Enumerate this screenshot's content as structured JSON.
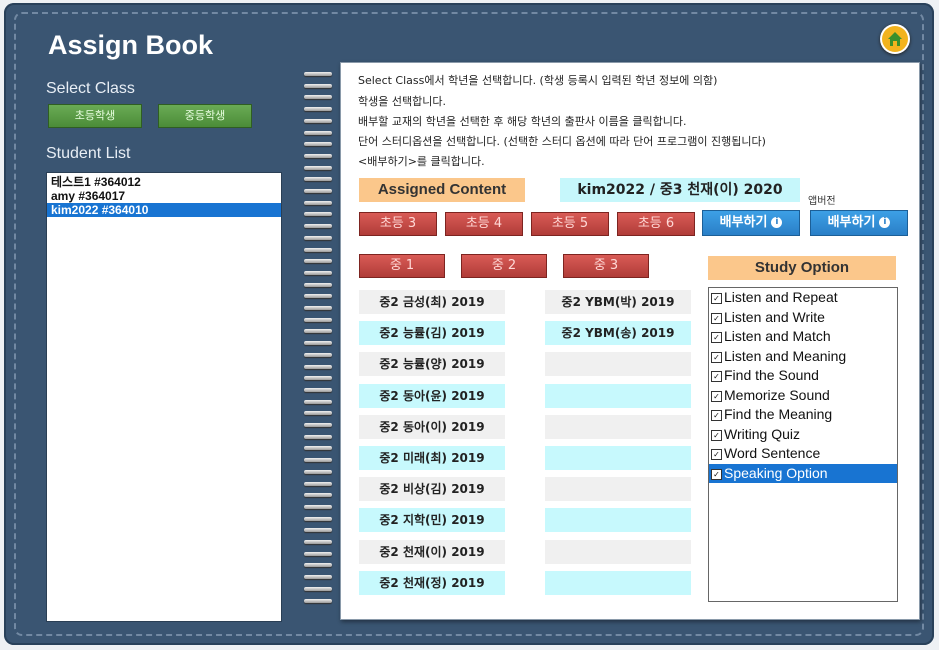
{
  "app": {
    "title": "Assign Book"
  },
  "sidebar": {
    "select_class_label": "Select Class",
    "class_buttons": [
      "초등학생",
      "중등학생"
    ],
    "student_list_label": "Student List",
    "students": [
      "테스트1 #364012",
      "amy #364017",
      "kim2022 #364010"
    ],
    "selected_student": "kim2022 #364010"
  },
  "instructions": [
    "Select Class에서 학년을 선택합니다. (학생 등록시 입력된 학년 정보에 의함)",
    "학생을 선택합니다.",
    "배부할 교재의 학년을 선택한 후 해당 학년의 출판사 이름을 클릭합니다.",
    "단어 스터디옵션을 선택합니다. (선택한 스터디 옵션에 따라 단어 프로그램이 진행됩니다)",
    "<배부하기>를 클릭합니다."
  ],
  "assigned": {
    "label": "Assigned Content",
    "value": "kim2022 / 중3 천재(이) 2020"
  },
  "app_version_label": "앱버전",
  "elementary_grades": [
    "초등 3",
    "초등 4",
    "초등 5",
    "초등 6"
  ],
  "middle_grades": [
    "중 1",
    "중 2",
    "중 3"
  ],
  "assign_buttons": [
    "배부하기",
    "배부하기"
  ],
  "books_col1": [
    "중2 금성(최) 2019",
    "중2 능률(김) 2019",
    "중2 능률(양) 2019",
    "중2 동아(윤) 2019",
    "중2 동아(이) 2019",
    "중2 미래(최) 2019",
    "중2 비상(김) 2019",
    "중2 지학(민) 2019",
    "중2 천재(이) 2019",
    "중2 천재(정) 2019"
  ],
  "books_col2": [
    "중2 YBM(박) 2019",
    "중2 YBM(송) 2019",
    "",
    "",
    "",
    "",
    "",
    "",
    "",
    ""
  ],
  "study_option": {
    "title": "Study Option",
    "options": [
      "Listen and Repeat",
      "Listen and Write",
      "Listen and Match",
      "Listen and Meaning",
      "Find the Sound",
      "Memorize Sound",
      "Find the Meaning",
      "Writing Quiz",
      "Word Sentence",
      "Speaking Option"
    ],
    "selected": "Speaking Option"
  },
  "colors": {
    "frame": "#3a5572",
    "accent_blue": "#1874d2",
    "red_button": "#c44a46",
    "green_button": "#5a9c46",
    "orange_header": "#fbc78b",
    "cyan_cell": "#c7f9fd"
  },
  "icons": {
    "home": "home-icon",
    "info": "info-icon",
    "check": "checkbox-icon"
  }
}
